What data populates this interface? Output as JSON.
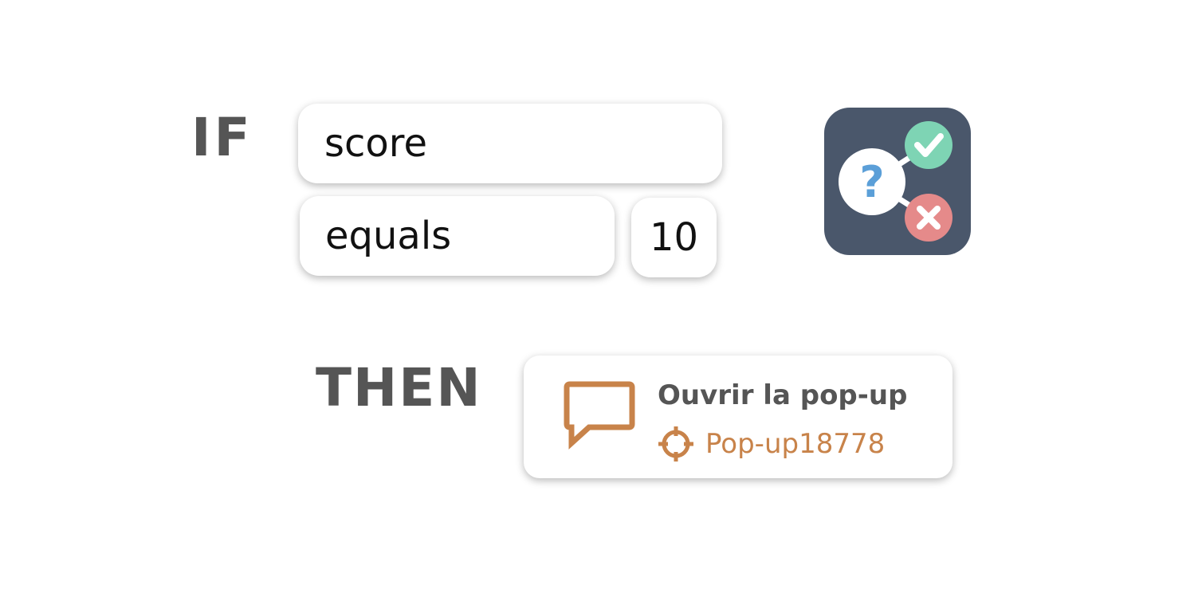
{
  "rule": {
    "if_keyword": "IF",
    "then_keyword": "THEN",
    "condition": {
      "variable": "score",
      "operator": "equals",
      "value": "10"
    },
    "action": {
      "title": "Ouvrir la pop-up",
      "target": "Pop-up18778",
      "icon": "speech-bubble-icon",
      "target_icon": "crosshair-icon"
    },
    "logic_icon": "condition-branch-icon"
  },
  "colors": {
    "keyword": "#555555",
    "icon_background": "#4a576b",
    "check_green": "#7ed4b4",
    "cross_red": "#e58a8a",
    "question_blue": "#5b9fd8",
    "action_accent": "#c8834a"
  }
}
